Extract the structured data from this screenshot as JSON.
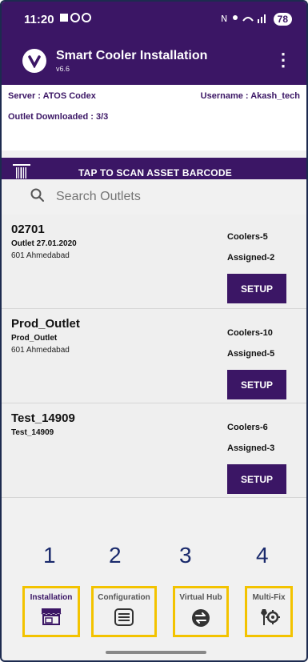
{
  "status_bar": {
    "time": "11:20",
    "battery": "78"
  },
  "app": {
    "title": "Smart Cooler Installation",
    "version": "v6.6"
  },
  "info": {
    "server": "Server : ATOS Codex",
    "username": "Username : Akash_tech",
    "downloaded": "Outlet Downloaded : 3/3"
  },
  "scan": {
    "label": "TAP TO SCAN ASSET BARCODE"
  },
  "search": {
    "placeholder": "Search Outlets"
  },
  "outlets": [
    {
      "name": "02701",
      "sub": "Outlet 27.01.2020",
      "location": "601 Ahmedabad",
      "coolers": "Coolers-5",
      "assigned": "Assigned-2",
      "button": "SETUP"
    },
    {
      "name": "Prod_Outlet",
      "sub": "Prod_Outlet",
      "location": "601 Ahmedabad",
      "coolers": "Coolers-10",
      "assigned": "Assigned-5",
      "button": "SETUP"
    },
    {
      "name": "Test_14909",
      "sub": "Test_14909",
      "location": "",
      "coolers": "Coolers-6",
      "assigned": "Assigned-3",
      "button": "SETUP"
    }
  ],
  "nav": [
    {
      "num": "1",
      "label": "Installation",
      "icon": "storefront-icon"
    },
    {
      "num": "2",
      "label": "Configuration",
      "icon": "list-icon"
    },
    {
      "num": "3",
      "label": "Virtual Hub",
      "icon": "sync-icon"
    },
    {
      "num": "4",
      "label": "Multi-Fix",
      "icon": "tools-icon"
    }
  ],
  "colors": {
    "primary": "#3b1665",
    "highlight": "#f3c300",
    "annotation": "#1a2a6c"
  }
}
